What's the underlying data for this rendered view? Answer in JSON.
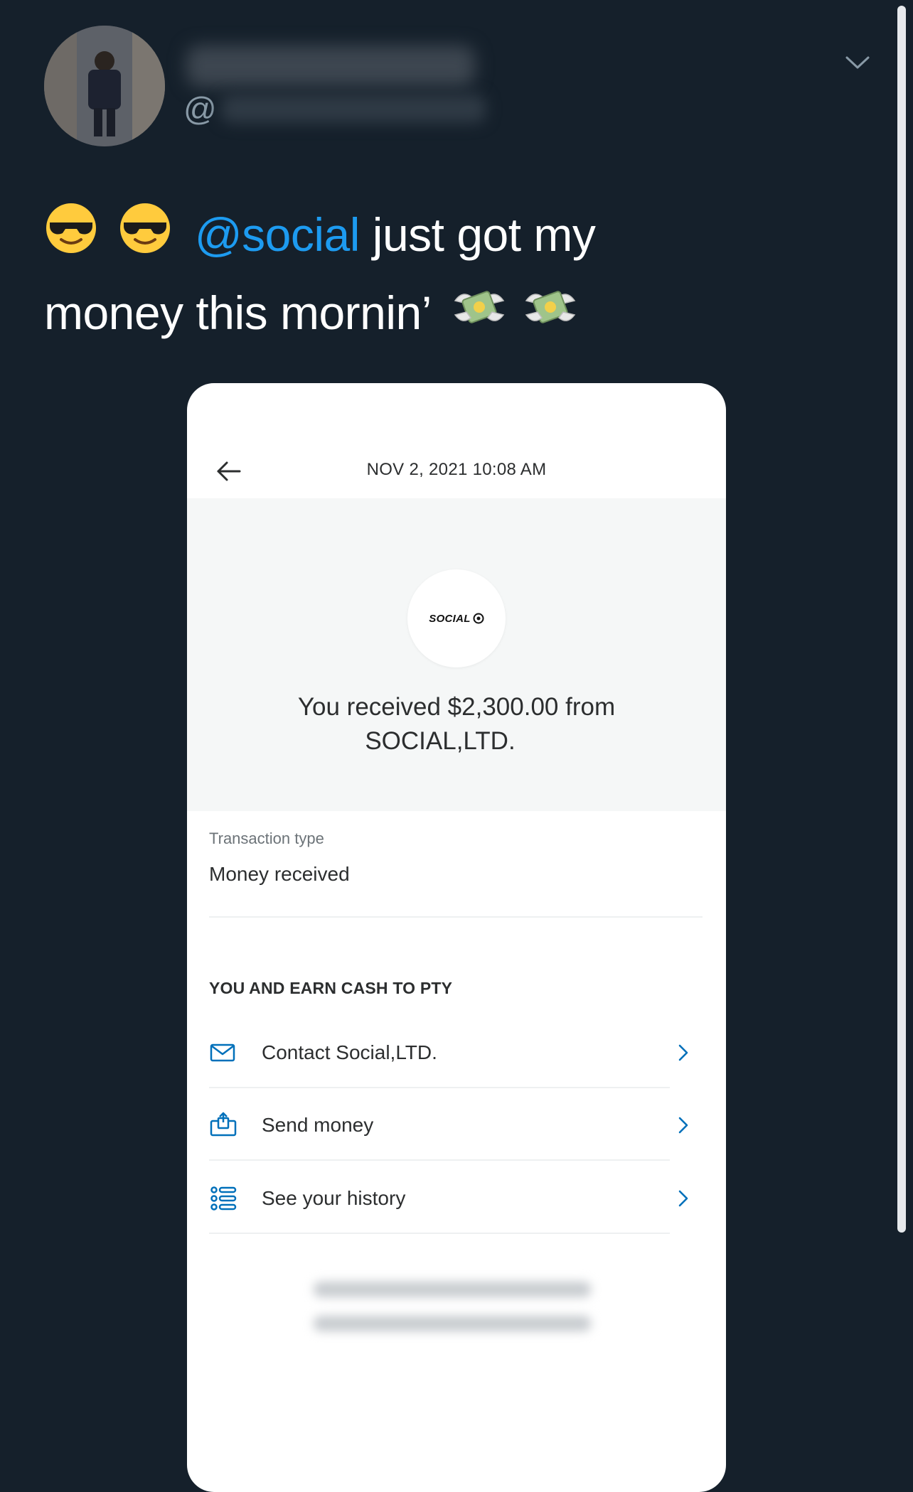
{
  "tweet": {
    "handle_prefix": "@",
    "mention": "@social",
    "text_after_mention": "just got my",
    "text_line2": "money this mornin’"
  },
  "screenshot": {
    "date": "NOV 2, 2021 10:08 AM",
    "logo_text": "SOCIAL",
    "received_text_line1": "You received $2,300.00 from",
    "received_text_line2": "SOCIAL,LTD.",
    "transaction_type_label": "Transaction type",
    "transaction_type_value": "Money received",
    "section_heading": "YOU AND EARN CASH TO PTY",
    "actions": [
      {
        "label": "Contact Social,LTD.",
        "icon": "mail-icon"
      },
      {
        "label": "Send money",
        "icon": "send-money-icon"
      },
      {
        "label": "See your history",
        "icon": "history-list-icon"
      }
    ]
  },
  "colors": {
    "background": "#15202b",
    "mention": "#1d9bf0",
    "accent_icon": "#0070ba"
  }
}
